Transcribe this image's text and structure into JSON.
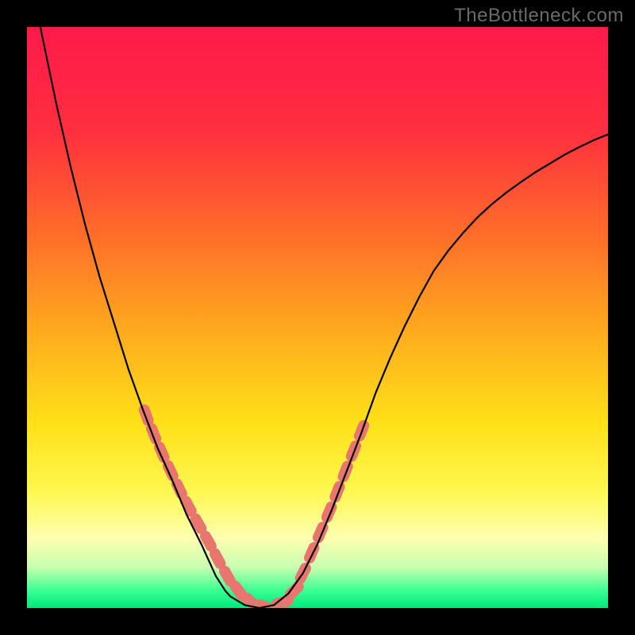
{
  "watermark": "TheBottleneck.com",
  "colors": {
    "frame": "#000000",
    "gradient_stops": [
      {
        "offset": 0.0,
        "color": "#ff1a4a"
      },
      {
        "offset": 0.18,
        "color": "#ff2f3f"
      },
      {
        "offset": 0.35,
        "color": "#ff6a2a"
      },
      {
        "offset": 0.52,
        "color": "#ffa91e"
      },
      {
        "offset": 0.68,
        "color": "#ffe018"
      },
      {
        "offset": 0.8,
        "color": "#fff850"
      },
      {
        "offset": 0.88,
        "color": "#fdffb0"
      },
      {
        "offset": 0.93,
        "color": "#c8ffb0"
      },
      {
        "offset": 0.97,
        "color": "#3bff93"
      },
      {
        "offset": 1.0,
        "color": "#00e878"
      }
    ],
    "curve": "#000000",
    "markers": "#e8766f"
  },
  "chart_data": {
    "type": "line",
    "title": "",
    "xlabel": "",
    "ylabel": "",
    "xlim": [
      0,
      1
    ],
    "ylim": [
      0,
      1
    ],
    "series": [
      {
        "name": "bottleneck-curve",
        "x": [
          0.0,
          0.025,
          0.05,
          0.075,
          0.1,
          0.125,
          0.15,
          0.175,
          0.2,
          0.225,
          0.25,
          0.275,
          0.3,
          0.325,
          0.341,
          0.35,
          0.375,
          0.4,
          0.425,
          0.45,
          0.475,
          0.5,
          0.525,
          0.55,
          0.575,
          0.6,
          0.625,
          0.65,
          0.675,
          0.7,
          0.725,
          0.75,
          0.775,
          0.8,
          0.825,
          0.85,
          0.875,
          0.9,
          0.925,
          0.95,
          0.975,
          1.0
        ],
        "y": [
          1.12,
          0.99,
          0.87,
          0.76,
          0.66,
          0.57,
          0.49,
          0.41,
          0.34,
          0.275,
          0.22,
          0.16,
          0.11,
          0.055,
          0.03,
          0.02,
          0.005,
          0.0,
          0.005,
          0.025,
          0.06,
          0.11,
          0.17,
          0.235,
          0.3,
          0.37,
          0.43,
          0.485,
          0.535,
          0.58,
          0.615,
          0.645,
          0.672,
          0.695,
          0.715,
          0.733,
          0.75,
          0.765,
          0.78,
          0.793,
          0.805,
          0.815
        ]
      }
    ],
    "markers": {
      "name": "highlighted-points",
      "x": [
        0.205,
        0.218,
        0.232,
        0.247,
        0.262,
        0.278,
        0.295,
        0.312,
        0.328,
        0.345,
        0.364,
        0.386,
        0.41,
        0.44,
        0.46,
        0.475,
        0.49,
        0.505,
        0.52,
        0.534,
        0.548,
        0.562,
        0.576
      ],
      "y": [
        0.332,
        0.3,
        0.268,
        0.236,
        0.205,
        0.175,
        0.145,
        0.115,
        0.085,
        0.055,
        0.03,
        0.01,
        0.002,
        0.01,
        0.03,
        0.06,
        0.095,
        0.13,
        0.165,
        0.2,
        0.235,
        0.27,
        0.305
      ]
    }
  }
}
